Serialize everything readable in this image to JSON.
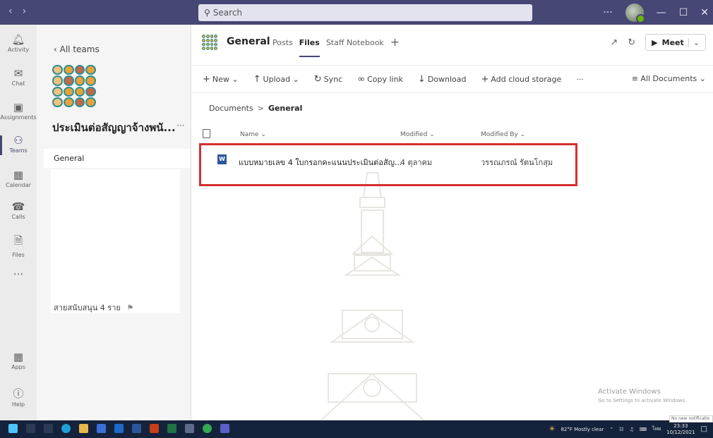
{
  "titlebar": {
    "nav_back": "‹",
    "nav_forward": "›",
    "search_placeholder": "Search",
    "more": "···",
    "minimize": "—",
    "maximize": "☐",
    "close": "✕"
  },
  "rail": {
    "items": [
      {
        "label": "Activity",
        "icon": "bell-icon"
      },
      {
        "label": "Chat",
        "icon": "chat-icon"
      },
      {
        "label": "Assignments",
        "icon": "assignments-icon"
      },
      {
        "label": "Teams",
        "icon": "teams-icon"
      },
      {
        "label": "Calendar",
        "icon": "calendar-icon"
      },
      {
        "label": "Calls",
        "icon": "phone-icon"
      },
      {
        "label": "Files",
        "icon": "file-icon"
      },
      {
        "label": "···",
        "icon": "more-icon"
      },
      {
        "label": "Apps",
        "icon": "apps-icon"
      },
      {
        "label": "Help",
        "icon": "help-icon"
      }
    ]
  },
  "team_panel": {
    "back_label": "All teams",
    "team_name": "ประเมินต่อสัญญาจ้างพนั...",
    "more": "···",
    "channels": [
      "General",
      "สายสนับสนุน 4 ราย"
    ]
  },
  "channel_header": {
    "title": "General",
    "tabs": [
      "Posts",
      "Files",
      "Staff Notebook"
    ],
    "add_tab": "+",
    "meet_label": "Meet"
  },
  "toolbar": {
    "new": "New",
    "upload": "Upload",
    "sync": "Sync",
    "copy_link": "Copy link",
    "download": "Download",
    "add_cloud": "Add cloud storage",
    "more": "···",
    "view": "All Documents"
  },
  "breadcrumb": {
    "root": "Documents",
    "current": "General"
  },
  "file_list": {
    "headers": {
      "name": "Name",
      "modified": "Modified",
      "modified_by": "Modified By"
    },
    "rows": [
      {
        "name": "แบบหมายเลข 4 ใบกรอกคะแนนประเมินต่อสัญ...",
        "modified": "4 ตุลาคม",
        "modified_by": "วรรณภรณ์ รัตนโกสุม",
        "type": "word"
      }
    ]
  },
  "activation": {
    "title": "Activate Windows",
    "subtitle": "Go to Settings to activate Windows."
  },
  "taskbar": {
    "weather": "82°F  Mostly clear",
    "lang": "ไทย",
    "time": "23:33",
    "date": "10/12/2021",
    "notification": "No new notificatio"
  },
  "colors": {
    "titlebar": "#464775",
    "highlight": "#d32f2f",
    "word": "#2b579a"
  }
}
